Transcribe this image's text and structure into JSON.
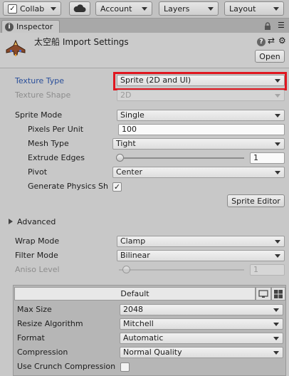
{
  "toolbar": {
    "collab_label": "Collab",
    "cloud_icon": "cloud-icon",
    "account_label": "Account",
    "layers_label": "Layers",
    "layout_label": "Layout"
  },
  "tab": {
    "label": "Inspector",
    "icon": "info-icon"
  },
  "header": {
    "title": "太空船 Import Settings",
    "open_label": "Open",
    "icons": [
      "help-icon",
      "preset-icon",
      "settings-icon"
    ]
  },
  "fields": {
    "texture_type": {
      "label": "Texture Type",
      "value": "Sprite (2D and UI)"
    },
    "texture_shape": {
      "label": "Texture Shape",
      "value": "2D"
    },
    "sprite_mode": {
      "label": "Sprite Mode",
      "value": "Single"
    },
    "pixels_per_unit": {
      "label": "Pixels Per Unit",
      "value": "100"
    },
    "mesh_type": {
      "label": "Mesh Type",
      "value": "Tight"
    },
    "extrude_edges": {
      "label": "Extrude Edges",
      "value": "1",
      "slider_fraction": 0.03
    },
    "pivot": {
      "label": "Pivot",
      "value": "Center"
    },
    "generate_physics_shape": {
      "label": "Generate Physics Sh",
      "checked": true,
      "check_glyph": "✓"
    },
    "sprite_editor_label": "Sprite Editor",
    "advanced": {
      "label": "Advanced",
      "expanded": false
    },
    "wrap_mode": {
      "label": "Wrap Mode",
      "value": "Clamp"
    },
    "filter_mode": {
      "label": "Filter Mode",
      "value": "Bilinear"
    },
    "aniso_level": {
      "label": "Aniso Level",
      "value": "1",
      "slider_fraction": 0.06
    }
  },
  "platform": {
    "default_tab": "Default",
    "tabs_icons": [
      "monitor-icon",
      "windows-icon"
    ],
    "max_size": {
      "label": "Max Size",
      "value": "2048"
    },
    "resize_algorithm": {
      "label": "Resize Algorithm",
      "value": "Mitchell"
    },
    "format": {
      "label": "Format",
      "value": "Automatic"
    },
    "compression": {
      "label": "Compression",
      "value": "Normal Quality"
    },
    "use_crunch": {
      "label": "Use Crunch Compression",
      "checked": false
    }
  },
  "colors": {
    "highlight": "#e0161f",
    "label_blue": "#2a4f9a",
    "window_bg": "#c8c8c8"
  }
}
